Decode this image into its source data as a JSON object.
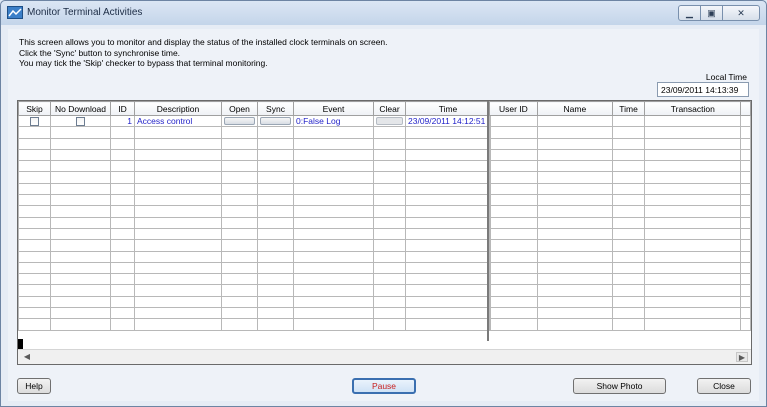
{
  "window": {
    "title": "Monitor Terminal Activities"
  },
  "info_lines": [
    "This screen allows you to monitor and display the status of the installed clock terminals on screen.",
    "Click the 'Sync' button to synchronise time.",
    "You may tick the 'Skip' checker to bypass that terminal monitoring."
  ],
  "local_time": {
    "label": "Local Time",
    "value": "23/09/2011 14:13:39"
  },
  "terminals": {
    "headers": [
      "Skip",
      "No Download",
      "ID",
      "Description",
      "Open",
      "Sync",
      "Event",
      "Clear",
      "Time"
    ],
    "rows": [
      {
        "id": "1",
        "description": "Access control",
        "event": "0:False Log",
        "time": "23/09/2011 14:12:51"
      }
    ]
  },
  "transactions": {
    "headers": [
      "User ID",
      "Name",
      "Time",
      "Transaction"
    ]
  },
  "buttons": {
    "help": "Help",
    "pause": "Pause",
    "show_photo": "Show Photo",
    "close": "Close"
  },
  "colors": {
    "link_blue": "#1f1fc8",
    "pause_red": "#c81e1e"
  }
}
